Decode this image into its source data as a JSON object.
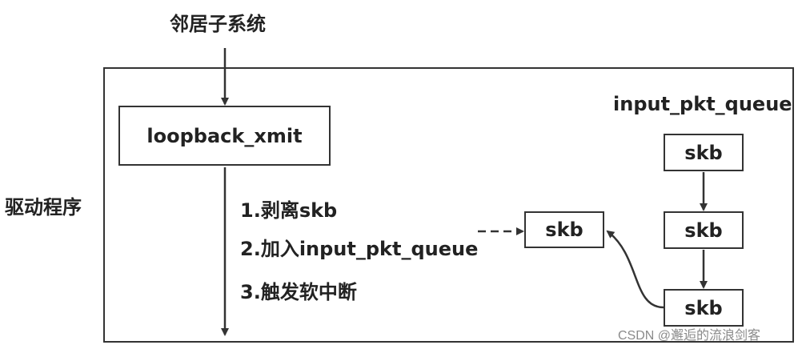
{
  "labels": {
    "neighbor_subsystem": "邻居子系统",
    "driver_program": "驱动程序",
    "queue_name": "input_pkt_queue",
    "step1": "1.剥离skb",
    "step2": "2.加入input_pkt_queue",
    "step3": "3.触发软中断"
  },
  "nodes": {
    "loopback": "loopback_xmit",
    "skb_mid": "skb",
    "skb_q1": "skb",
    "skb_q2": "skb",
    "skb_q3": "skb"
  },
  "watermark": "CSDN @邂逅的流浪剑客"
}
